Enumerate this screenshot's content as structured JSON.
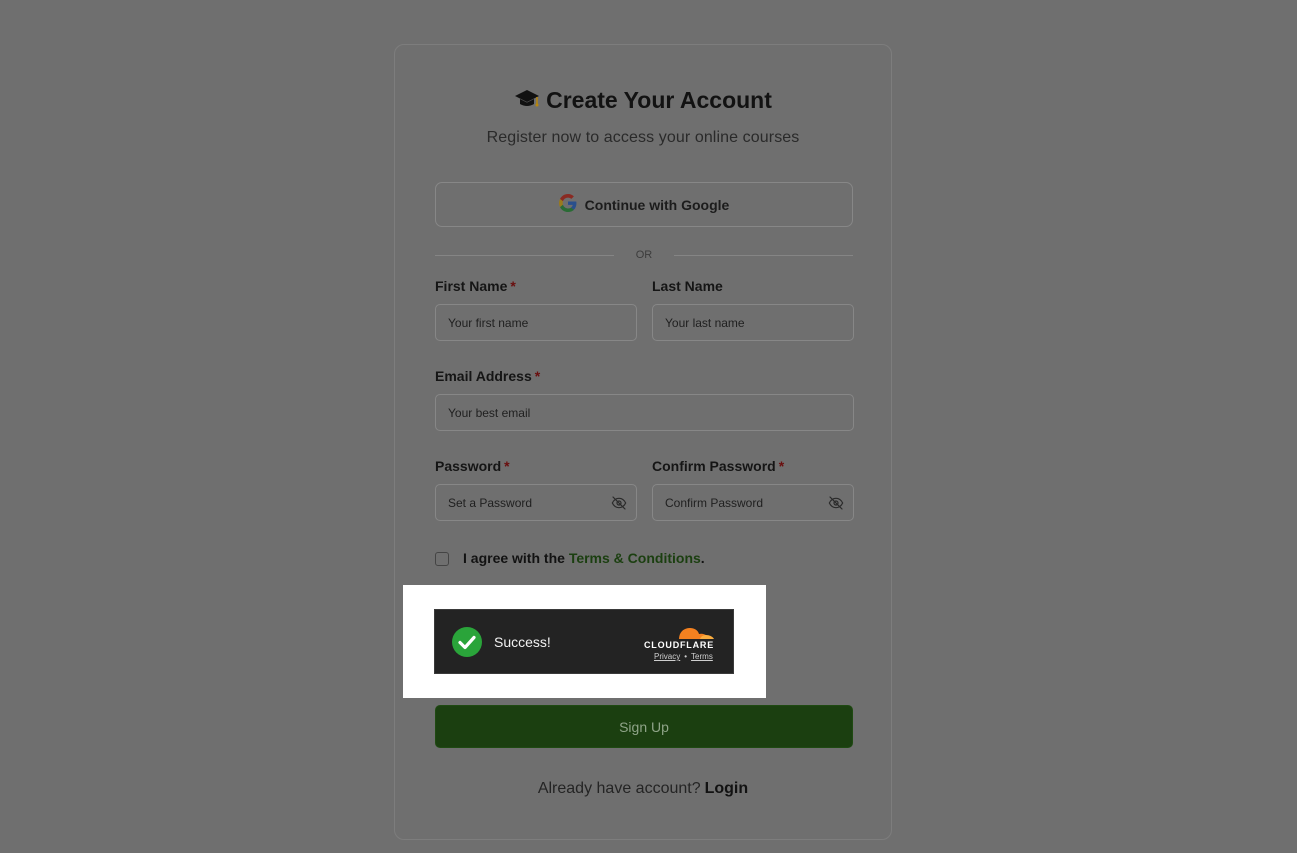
{
  "header": {
    "title": "Create Your Account",
    "subtitle": "Register now to access your online courses"
  },
  "google": {
    "label": "Continue with Google"
  },
  "divider": {
    "text": "OR"
  },
  "form": {
    "first_name": {
      "label": "First Name",
      "required": "*",
      "placeholder": "Your first name"
    },
    "last_name": {
      "label": "Last Name",
      "placeholder": "Your last name"
    },
    "email": {
      "label": "Email Address",
      "required": "*",
      "placeholder": "Your best email"
    },
    "password": {
      "label": "Password",
      "required": "*",
      "placeholder": "Set a Password"
    },
    "confirm_password": {
      "label": "Confirm Password",
      "required": "*",
      "placeholder": "Confirm Password"
    },
    "agree": {
      "prefix": "I agree with the",
      "link": "Terms & Conditions",
      "suffix": "."
    }
  },
  "captcha": {
    "status": "Success!",
    "brand": "CLOUDFLARE",
    "privacy": "Privacy",
    "separator": "•",
    "terms": "Terms"
  },
  "actions": {
    "signup_label": "Sign Up",
    "login_prompt": "Already have account?",
    "login_label": "Login"
  },
  "colors": {
    "primary_green": "#1b3f10",
    "required_red": "#6a0e0e",
    "cloudflare_orange": "#f48120",
    "success_green": "#2aa43a"
  },
  "icons": {
    "title_icon": "graduation-cap-icon",
    "google": "google-icon",
    "password_toggle": "eye-off-icon",
    "captcha_status": "check-circle-icon",
    "captcha_brand": "cloudflare-logo"
  }
}
